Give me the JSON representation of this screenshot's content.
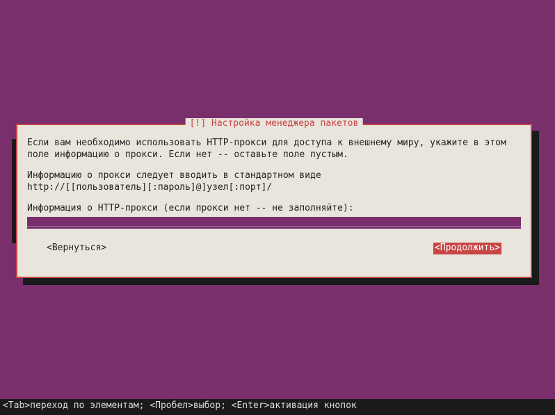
{
  "dialog": {
    "title": "[!] Настройка менеджера пакетов",
    "para1": "Если вам необходимо использовать HTTP-прокси для доступа к внешнему миру, укажите в этом поле информацию о прокси. Если нет -- оставьте поле пустым.",
    "para2": "Информацию о прокси следует вводить в стандартном виде\nhttp://[[пользователь][:пароль]@]узел[:порт]/",
    "prompt": "Информация о HTTP-прокси (если прокси нет -- не заполняйте):",
    "input_value": "",
    "underscores": "___________________________________________________________________________________________",
    "back_label": "<Вернуться>",
    "continue_label": "<Продолжить>"
  },
  "statusbar": {
    "text": "<Tab>переход по элементам; <Пробел>выбор; <Enter>активация кнопок"
  },
  "colors": {
    "bg": "#7a2f6d",
    "panel": "#e9e5dc",
    "border": "#c74545",
    "accent": "#c74545",
    "shadow": "#1a1a1a"
  }
}
